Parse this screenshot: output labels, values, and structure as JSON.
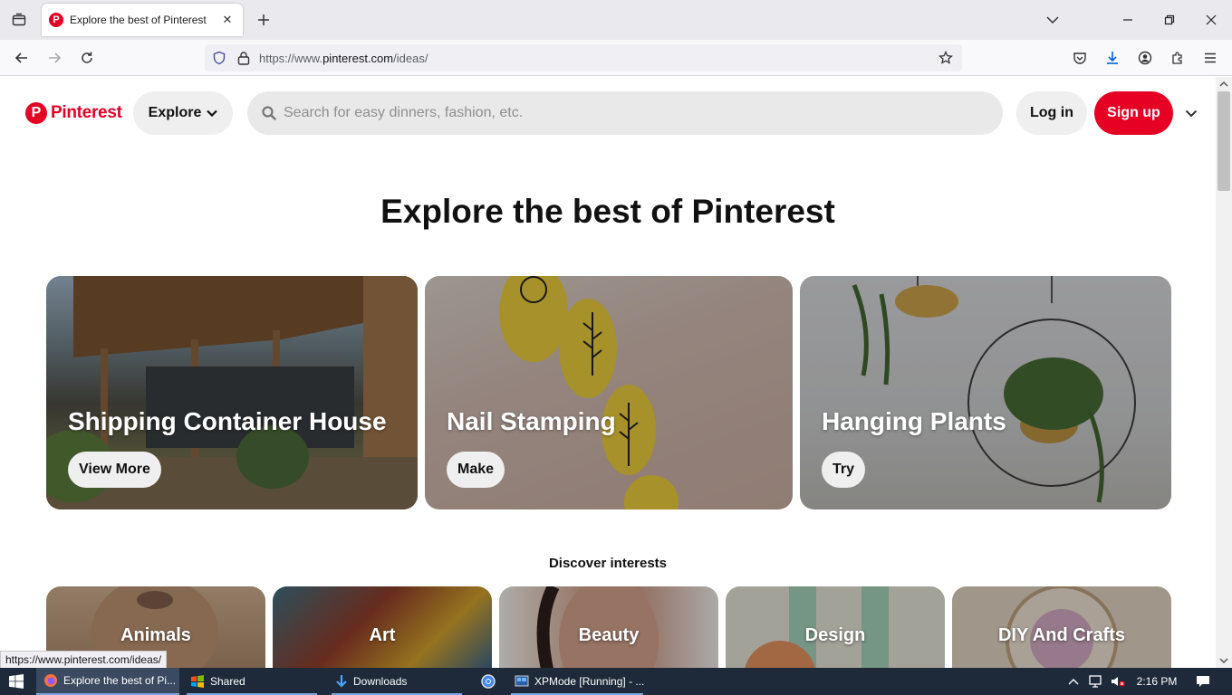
{
  "browser": {
    "tab_title": "Explore the best of Pinterest",
    "url_prefix": "https://www.",
    "url_domain": "pinterest.com",
    "url_path": "/ideas/",
    "status_url": "https://www.pinterest.com/ideas/"
  },
  "header": {
    "logo_text": "Pinterest",
    "explore_label": "Explore",
    "search_placeholder": "Search for easy dinners, fashion, etc.",
    "login_label": "Log in",
    "signup_label": "Sign up"
  },
  "main": {
    "heading": "Explore the best of Pinterest",
    "cards": [
      {
        "title": "Shipping Container House",
        "button": "View More"
      },
      {
        "title": "Nail Stamping",
        "button": "Make"
      },
      {
        "title": "Hanging Plants",
        "button": "Try"
      }
    ],
    "discover_label": "Discover interests",
    "interests": [
      "Animals",
      "Art",
      "Beauty",
      "Design",
      "DIY And Crafts"
    ]
  },
  "taskbar": {
    "items": [
      "Explore the best of Pi...",
      "Shared",
      "Downloads",
      "XPMode [Running] - ..."
    ],
    "time": "2:16 PM"
  },
  "colors": {
    "brand": "#e60023",
    "taskbar": "#1e2a3a"
  }
}
